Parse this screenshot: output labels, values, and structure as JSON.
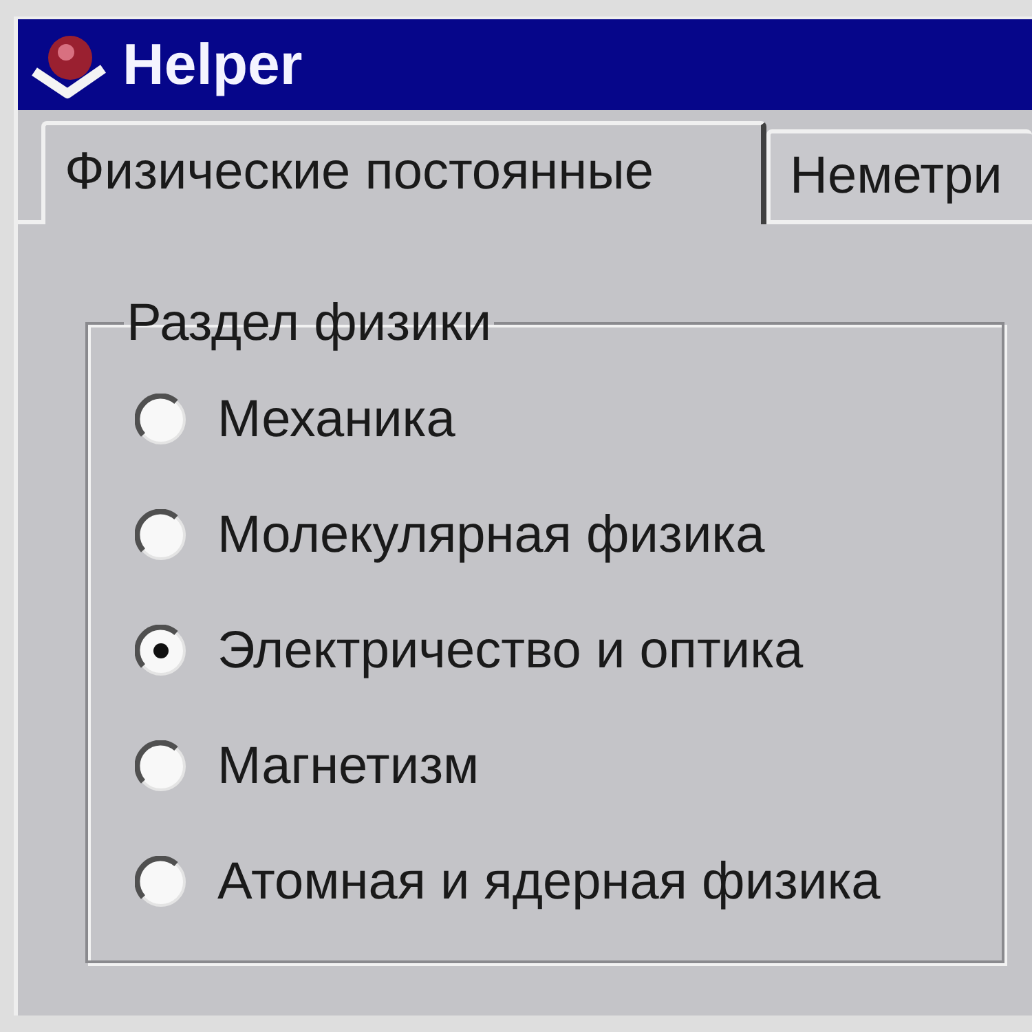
{
  "window": {
    "title": "Helper"
  },
  "tabs": [
    {
      "label": "Физические постоянные",
      "selected": true
    },
    {
      "label": "Неметри",
      "selected": false
    }
  ],
  "group": {
    "title": "Раздел физики",
    "options": [
      {
        "label": "Механика",
        "selected": false
      },
      {
        "label": "Молекулярная физика",
        "selected": false
      },
      {
        "label": "Электричество и оптика",
        "selected": true
      },
      {
        "label": "Магнетизм",
        "selected": false
      },
      {
        "label": "Атомная и ядерная физика",
        "selected": false
      }
    ]
  }
}
